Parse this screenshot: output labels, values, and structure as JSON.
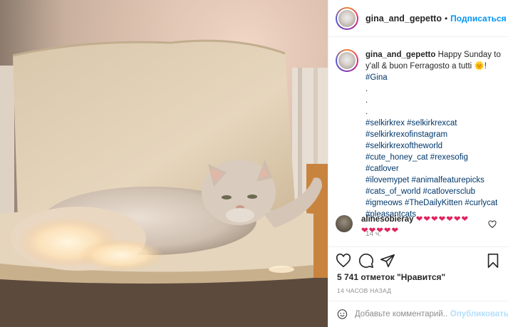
{
  "post": {
    "username": "gina_and_gepetto",
    "follow_label": "Подписаться",
    "caption_text": "Happy Sunday to y'all & buon Ferragosto a tutti",
    "caption_emoji": "🌞!",
    "caption_tag_name": "#Gina",
    "dots": [
      ".",
      ".",
      "."
    ],
    "hashtags": [
      "#selkirkrex #selkirkrexcat",
      "#selkirkrexofinstagram",
      "#selkirkrexoftheworld",
      "#cute_honey_cat #rexesofig #catlover",
      "#ilovemypet #animalfeaturepicks",
      "#cats_of_world #catloversclub",
      "#igmeows #TheDailyKitten #curlycat",
      "#pleasantcats"
    ],
    "caption_time": "14 ч.",
    "comment": {
      "username": "alinesobieray",
      "hearts_line1": "❤❤❤❤❤❤❤",
      "hearts_line2": "❤❤❤❤❤"
    },
    "likes": "5 741 отметок \"Нравится\"",
    "posted_ago": "14 ЧАСОВ НАЗАД",
    "comment_input_placeholder": "Добавьте комментарий...",
    "publish_label": "Опубликовать"
  },
  "colors": {
    "link_blue": "#0095f6",
    "hashtag_blue": "#00376b",
    "muted_gray": "#8e8e8e",
    "heart_red": "#e0245e"
  },
  "icons": [
    "heart-icon",
    "comment-icon",
    "share-icon",
    "bookmark-icon",
    "emoji-icon"
  ]
}
